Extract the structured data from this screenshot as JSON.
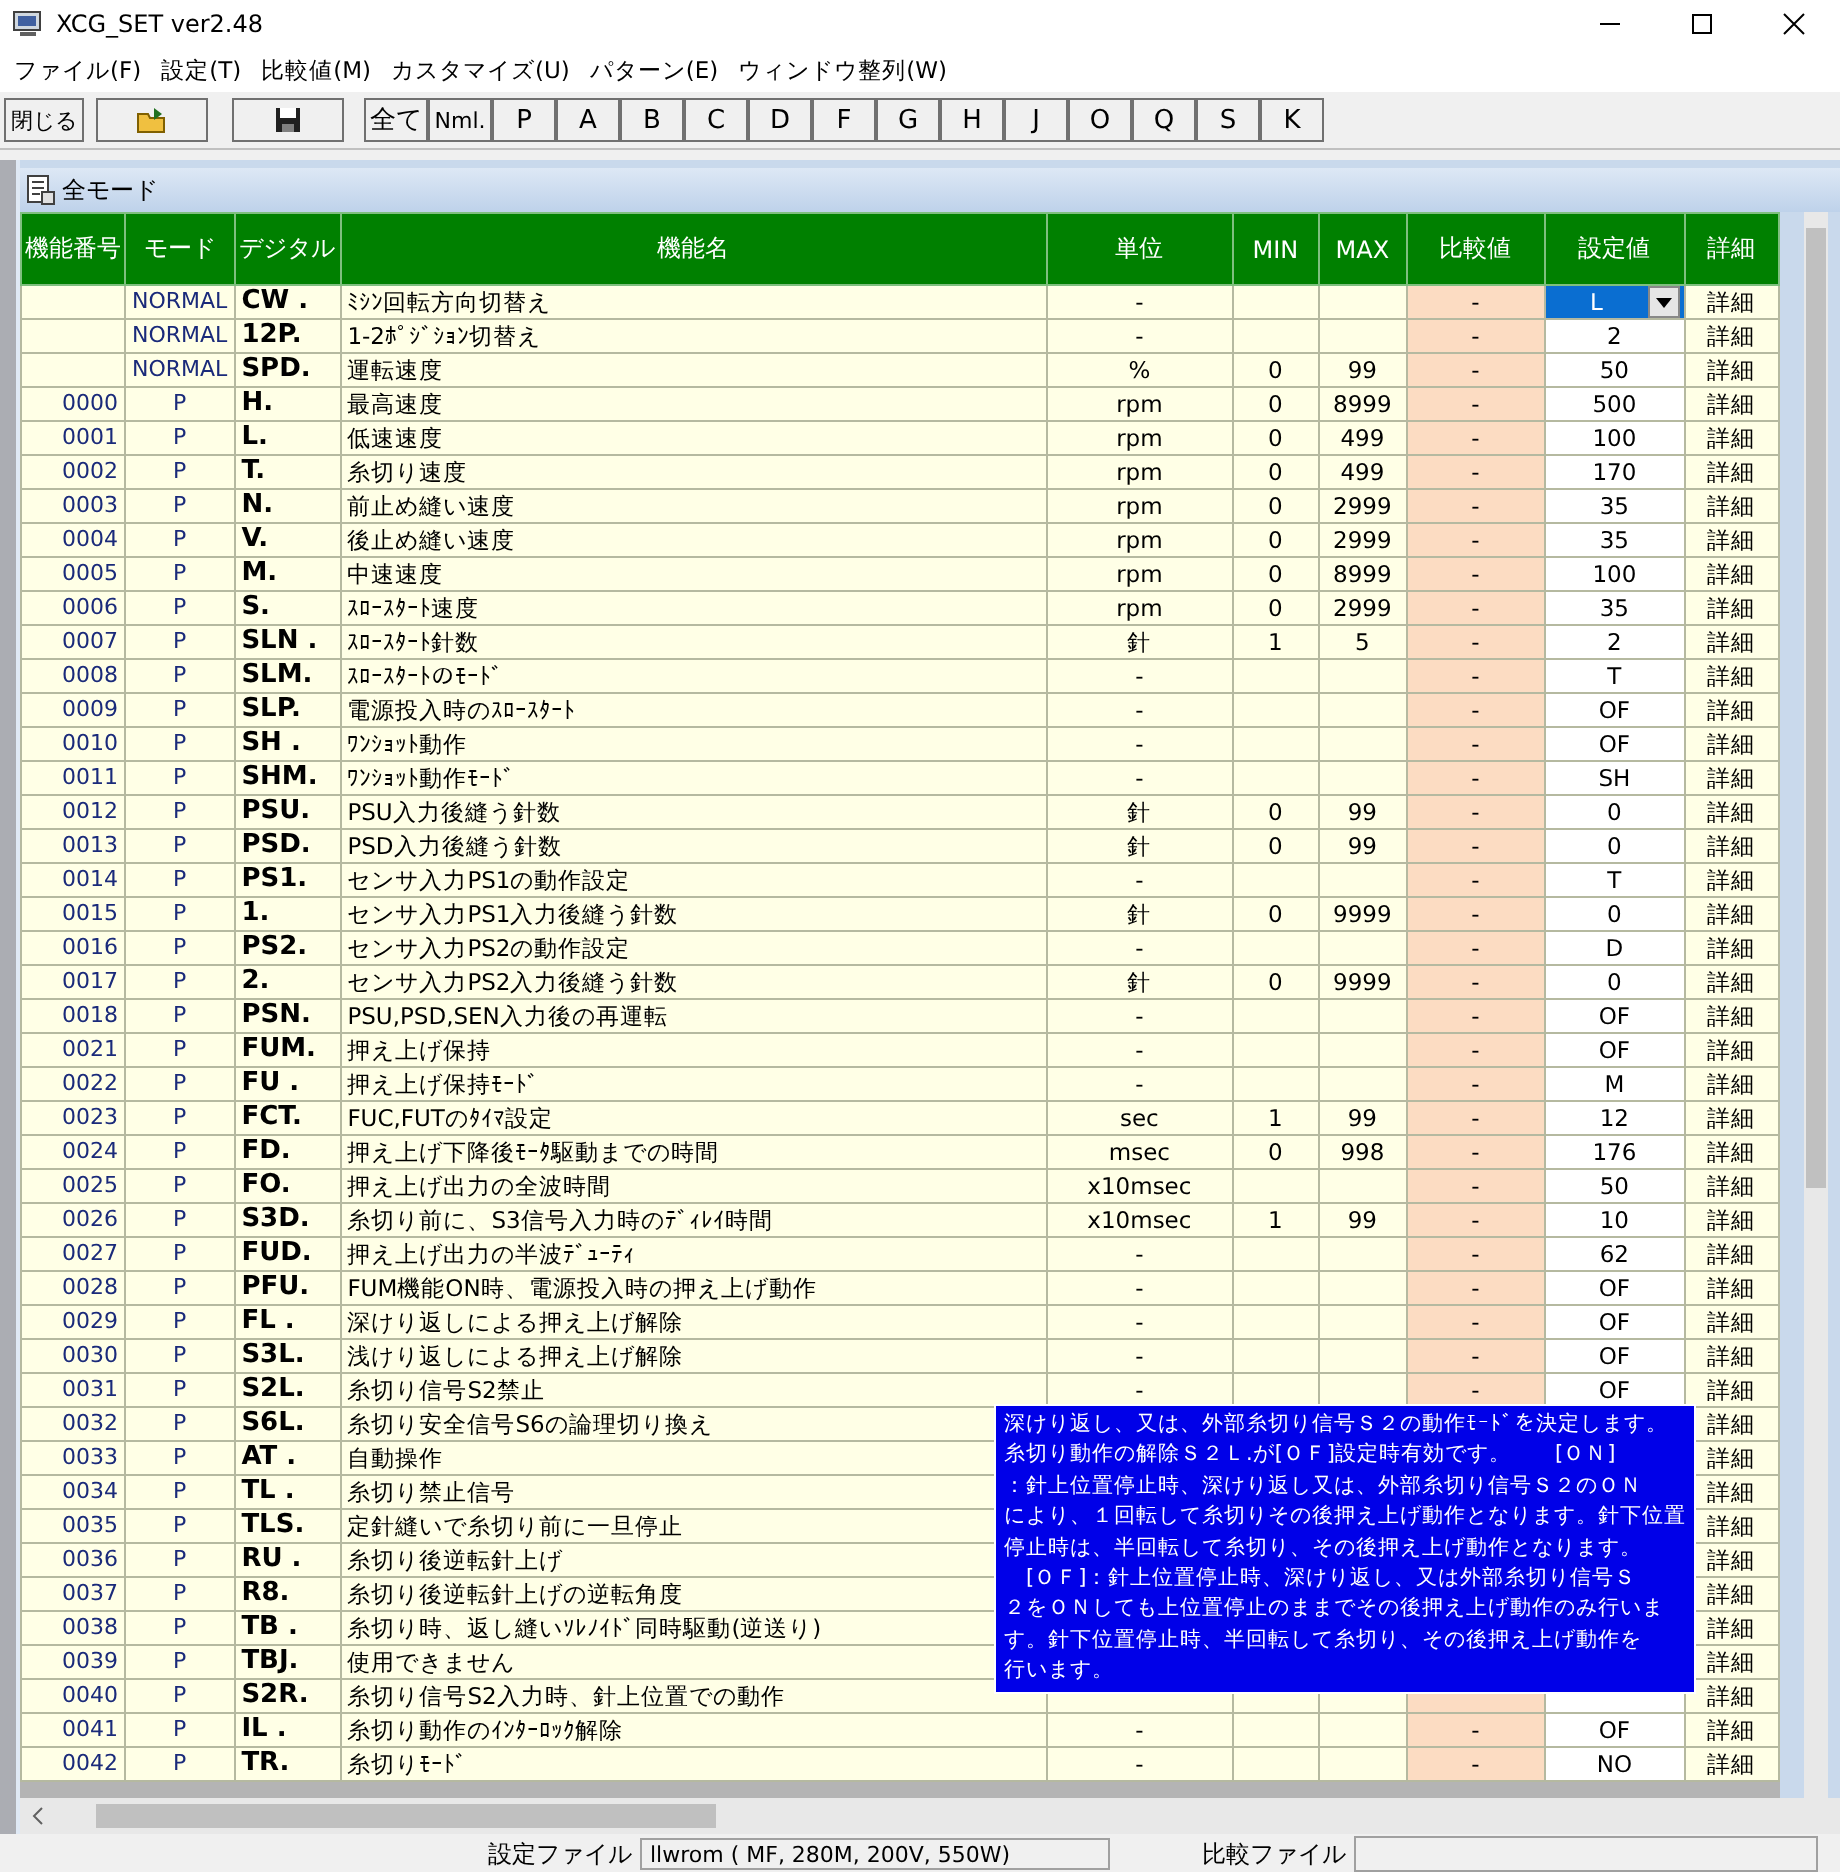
{
  "window": {
    "title": "XCG_SET ver2.48"
  },
  "menu": [
    "ファイル(F)",
    "設定(T)",
    "比較値(M)",
    "カスタマイズ(U)",
    "パターン(E)",
    "ウィンドウ整列(W)"
  ],
  "toolbar": {
    "close": "閉じる",
    "filters": [
      "全て",
      "Nml.",
      "P",
      "A",
      "B",
      "C",
      "D",
      "F",
      "G",
      "H",
      "J",
      "O",
      "Q",
      "S",
      "K"
    ]
  },
  "panel": {
    "title": "全モード"
  },
  "columns": [
    "機能番号",
    "モード",
    "デジタル",
    "機能名",
    "単位",
    "MIN",
    "MAX",
    "比較値",
    "設定値",
    "詳細"
  ],
  "rows": [
    {
      "mode": "NORMAL",
      "digital": "CW .",
      "name": "ﾐｼﾝ回転方向切替え",
      "unit": "-",
      "compare": "-",
      "setting": "L",
      "selected": true,
      "detail": "詳細"
    },
    {
      "mode": "NORMAL",
      "digital": "12P.",
      "name": "1-2ﾎﾟｼﾞｼｮﾝ切替え",
      "unit": "-",
      "compare": "-",
      "setting": "2",
      "selected": false,
      "detail": "詳細"
    },
    {
      "mode": "NORMAL",
      "digital": "SPD.",
      "name": "運転速度",
      "unit": "%",
      "min": "0",
      "max": "99",
      "compare": "-",
      "setting": "50",
      "selected": false,
      "detail": "詳細"
    },
    {
      "no": "0000",
      "mode": "P",
      "digital": "H.",
      "name": "最高速度",
      "unit": "rpm",
      "min": "0",
      "max": "8999",
      "compare": "-",
      "setting": "500",
      "selected": false,
      "detail": "詳細"
    },
    {
      "no": "0001",
      "mode": "P",
      "digital": "L.",
      "name": "低速速度",
      "unit": "rpm",
      "min": "0",
      "max": "499",
      "compare": "-",
      "setting": "100",
      "selected": false,
      "detail": "詳細"
    },
    {
      "no": "0002",
      "mode": "P",
      "digital": "T.",
      "name": "糸切り速度",
      "unit": "rpm",
      "min": "0",
      "max": "499",
      "compare": "-",
      "setting": "170",
      "selected": false,
      "detail": "詳細"
    },
    {
      "no": "0003",
      "mode": "P",
      "digital": "N.",
      "name": "前止め縫い速度",
      "unit": "rpm",
      "min": "0",
      "max": "2999",
      "compare": "-",
      "setting": "35",
      "selected": false,
      "detail": "詳細"
    },
    {
      "no": "0004",
      "mode": "P",
      "digital": "V.",
      "name": "後止め縫い速度",
      "unit": "rpm",
      "min": "0",
      "max": "2999",
      "compare": "-",
      "setting": "35",
      "selected": false,
      "detail": "詳細"
    },
    {
      "no": "0005",
      "mode": "P",
      "digital": "M.",
      "name": "中速速度",
      "unit": "rpm",
      "min": "0",
      "max": "8999",
      "compare": "-",
      "setting": "100",
      "selected": false,
      "detail": "詳細"
    },
    {
      "no": "0006",
      "mode": "P",
      "digital": "S.",
      "name": "ｽﾛｰｽﾀｰﾄ速度",
      "unit": "rpm",
      "min": "0",
      "max": "2999",
      "compare": "-",
      "setting": "35",
      "selected": false,
      "detail": "詳細"
    },
    {
      "no": "0007",
      "mode": "P",
      "digital": "SLN .",
      "name": "ｽﾛｰｽﾀｰﾄ針数",
      "unit": "針",
      "min": "1",
      "max": "5",
      "compare": "-",
      "setting": "2",
      "selected": false,
      "detail": "詳細"
    },
    {
      "no": "0008",
      "mode": "P",
      "digital": "SLM.",
      "name": "ｽﾛｰｽﾀｰﾄのﾓｰﾄﾞ",
      "unit": "-",
      "compare": "-",
      "setting": "T",
      "selected": false,
      "detail": "詳細"
    },
    {
      "no": "0009",
      "mode": "P",
      "digital": "SLP.",
      "name": "電源投入時のｽﾛｰｽﾀｰﾄ",
      "unit": "-",
      "compare": "-",
      "setting": "OF",
      "selected": false,
      "detail": "詳細"
    },
    {
      "no": "0010",
      "mode": "P",
      "digital": "SH .",
      "name": "ﾜﾝｼｮｯﾄ動作",
      "unit": "-",
      "compare": "-",
      "setting": "OF",
      "selected": false,
      "detail": "詳細"
    },
    {
      "no": "0011",
      "mode": "P",
      "digital": "SHM.",
      "name": "ﾜﾝｼｮｯﾄ動作ﾓｰﾄﾞ",
      "unit": "-",
      "compare": "-",
      "setting": "SH",
      "selected": false,
      "detail": "詳細"
    },
    {
      "no": "0012",
      "mode": "P",
      "digital": "PSU.",
      "name": "PSU入力後縫う針数",
      "unit": "針",
      "min": "0",
      "max": "99",
      "compare": "-",
      "setting": "0",
      "selected": false,
      "detail": "詳細"
    },
    {
      "no": "0013",
      "mode": "P",
      "digital": "PSD.",
      "name": "PSD入力後縫う針数",
      "unit": "針",
      "min": "0",
      "max": "99",
      "compare": "-",
      "setting": "0",
      "selected": false,
      "detail": "詳細"
    },
    {
      "no": "0014",
      "mode": "P",
      "digital": "PS1.",
      "name": "センサ入力PS1の動作設定",
      "unit": "-",
      "compare": "-",
      "setting": "T",
      "selected": false,
      "detail": "詳細"
    },
    {
      "no": "0015",
      "mode": "P",
      "digital": "1.",
      "name": "センサ入力PS1入力後縫う針数",
      "unit": "針",
      "min": "0",
      "max": "9999",
      "compare": "-",
      "setting": "0",
      "selected": false,
      "detail": "詳細"
    },
    {
      "no": "0016",
      "mode": "P",
      "digital": "PS2.",
      "name": "センサ入力PS2の動作設定",
      "unit": "-",
      "compare": "-",
      "setting": "D",
      "selected": false,
      "detail": "詳細"
    },
    {
      "no": "0017",
      "mode": "P",
      "digital": "2.",
      "name": "センサ入力PS2入力後縫う針数",
      "unit": "針",
      "min": "0",
      "max": "9999",
      "compare": "-",
      "setting": "0",
      "selected": false,
      "detail": "詳細"
    },
    {
      "no": "0018",
      "mode": "P",
      "digital": "PSN.",
      "name": "PSU,PSD,SEN入力後の再運転",
      "unit": "-",
      "compare": "-",
      "setting": "OF",
      "selected": false,
      "detail": "詳細"
    },
    {
      "no": "0021",
      "mode": "P",
      "digital": "FUM.",
      "name": "押え上げ保持",
      "unit": "-",
      "compare": "-",
      "setting": "OF",
      "selected": false,
      "detail": "詳細"
    },
    {
      "no": "0022",
      "mode": "P",
      "digital": "FU .",
      "name": "押え上げ保持ﾓｰﾄﾞ",
      "unit": "-",
      "compare": "-",
      "setting": "M",
      "selected": false,
      "detail": "詳細"
    },
    {
      "no": "0023",
      "mode": "P",
      "digital": "FCT.",
      "name": "FUC,FUTのﾀｲﾏ設定",
      "unit": "sec",
      "min": "1",
      "max": "99",
      "compare": "-",
      "setting": "12",
      "selected": false,
      "detail": "詳細"
    },
    {
      "no": "0024",
      "mode": "P",
      "digital": "FD.",
      "name": "押え上げ下降後ﾓｰﾀ駆動までの時間",
      "unit": "msec",
      "min": "0",
      "max": "998",
      "compare": "-",
      "setting": "176",
      "selected": false,
      "detail": "詳細"
    },
    {
      "no": "0025",
      "mode": "P",
      "digital": "FO.",
      "name": "押え上げ出力の全波時間",
      "unit": "x10msec",
      "compare": "-",
      "setting": "50",
      "selected": false,
      "detail": "詳細"
    },
    {
      "no": "0026",
      "mode": "P",
      "digital": "S3D.",
      "name": "糸切り前に、S3信号入力時のﾃﾞｨﾚｲ時間",
      "unit": "x10msec",
      "min": "1",
      "max": "99",
      "compare": "-",
      "setting": "10",
      "selected": false,
      "detail": "詳細"
    },
    {
      "no": "0027",
      "mode": "P",
      "digital": "FUD.",
      "name": "押え上げ出力の半波ﾃﾞｭｰﾃｨ",
      "unit": "-",
      "compare": "-",
      "setting": "62",
      "selected": false,
      "detail": "詳細"
    },
    {
      "no": "0028",
      "mode": "P",
      "digital": "PFU.",
      "name": "FUM機能ON時、電源投入時の押え上げ動作",
      "unit": "-",
      "compare": "-",
      "setting": "OF",
      "selected": false,
      "detail": "詳細"
    },
    {
      "no": "0029",
      "mode": "P",
      "digital": "FL .",
      "name": "深けり返しによる押え上げ解除",
      "unit": "-",
      "compare": "-",
      "setting": "OF",
      "selected": false,
      "detail": "詳細"
    },
    {
      "no": "0030",
      "mode": "P",
      "digital": "S3L.",
      "name": "浅けり返しによる押え上げ解除",
      "unit": "-",
      "compare": "-",
      "setting": "OF",
      "selected": false,
      "detail": "詳細"
    },
    {
      "no": "0031",
      "mode": "P",
      "digital": "S2L.",
      "name": "糸切り信号S2禁止",
      "unit": "-",
      "compare": "-",
      "setting": "OF",
      "selected": false,
      "detail": "詳細"
    },
    {
      "no": "0032",
      "mode": "P",
      "digital": "S6L.",
      "name": "糸切り安全信号S6の論理切り換え",
      "detail": "詳細"
    },
    {
      "no": "0033",
      "mode": "P",
      "digital": "AT .",
      "name": "自動操作",
      "detail": "詳細"
    },
    {
      "no": "0034",
      "mode": "P",
      "digital": "TL .",
      "name": "糸切り禁止信号",
      "detail": "詳細"
    },
    {
      "no": "0035",
      "mode": "P",
      "digital": "TLS.",
      "name": "定針縫いで糸切り前に一旦停止",
      "detail": "詳細"
    },
    {
      "no": "0036",
      "mode": "P",
      "digital": "RU .",
      "name": "糸切り後逆転針上げ",
      "detail": "詳細"
    },
    {
      "no": "0037",
      "mode": "P",
      "digital": "R8.",
      "name": "糸切り後逆転針上げの逆転角度",
      "detail": "詳細"
    },
    {
      "no": "0038",
      "mode": "P",
      "digital": "TB .",
      "name": "糸切り時、返し縫いｿﾚﾉｲﾄﾞ同時駆動(逆送り)",
      "detail": "詳細"
    },
    {
      "no": "0039",
      "mode": "P",
      "digital": "TBJ.",
      "name": "使用できません",
      "detail": "詳細"
    },
    {
      "no": "0040",
      "mode": "P",
      "digital": "S2R.",
      "name": "糸切り信号S2入力時、針上位置での動作",
      "detail": "詳細"
    },
    {
      "no": "0041",
      "mode": "P",
      "digital": "IL .",
      "name": "糸切り動作のｲﾝﾀｰﾛｯｸ解除",
      "unit": "-",
      "compare": "-",
      "setting": "OF",
      "selected": false,
      "detail": "詳細"
    },
    {
      "no": "0042",
      "mode": "P",
      "digital": "TR.",
      "name": "糸切りﾓｰﾄﾞ",
      "unit": "-",
      "compare": "-",
      "setting": "NO",
      "selected": false,
      "detail": "詳細"
    }
  ],
  "tooltip": {
    "lines": [
      "深けり返し、又は、外部糸切り信号Ｓ２の動作ﾓｰﾄﾞを決定します。",
      "糸切り動作の解除Ｓ２Ｌ.が[ＯＦ]設定時有効です。　　[ＯＮ]",
      "：針上位置停止時、深けり返し又は、外部糸切り信号Ｓ２のＯＮ",
      "により、１回転して糸切りその後押え上げ動作となります。針下位置",
      "停止時は、半回転して糸切り、その後押え上げ動作となります。",
      "　[ＯＦ]：針上位置停止時、深けり返し、又は外部糸切り信号Ｓ",
      "２をＯＮしても上位置停止のままでその後押え上げ動作のみ行いま",
      "す。針下位置停止時、半回転して糸切り、その後押え上げ動作を",
      "行います。"
    ]
  },
  "status_bar": {
    "settings_label": "設定ファイル",
    "settings_file": "llwrom ( MF, 280M, 200V, 550W)",
    "compare_label": "比較ファイル"
  }
}
